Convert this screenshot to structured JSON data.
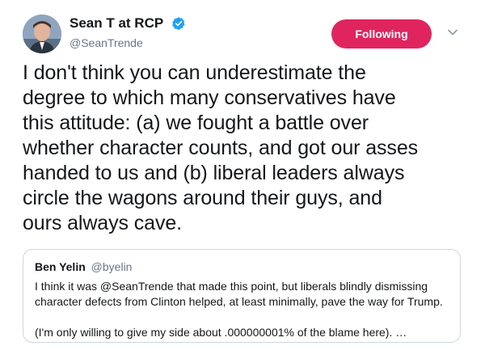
{
  "author": {
    "display_name": "Sean T at RCP",
    "handle": "@SeanTrende",
    "verified": true
  },
  "follow_button": {
    "label": "Following",
    "color": "#e0245e"
  },
  "tweet": {
    "lines": [
      "I don't think you can underestimate the",
      "degree to which many conservatives have",
      "this attitude: (a) we fought a battle over",
      "whether character counts, and  got our asses",
      "handed to us and (b) liberal leaders always",
      "circle the wagons around their guys, and",
      "ours always cave."
    ]
  },
  "quoted_tweet": {
    "display_name": "Ben Yelin",
    "handle": "@byelin",
    "lines": [
      "I think it was @SeanTrende that made this point, but liberals blindly dismissing",
      "character defects from Clinton helped, at least minimally, pave the way for Trump.",
      "(I'm only willing to give my side about .000000001% of the blame here). …"
    ]
  },
  "colors": {
    "text": "#14171a",
    "secondary": "#657786",
    "verified_badge": "#1da1f2",
    "border": "#ccd6dd"
  },
  "icons": {
    "verified": "verified-badge-icon",
    "menu": "chevron-down-icon"
  }
}
